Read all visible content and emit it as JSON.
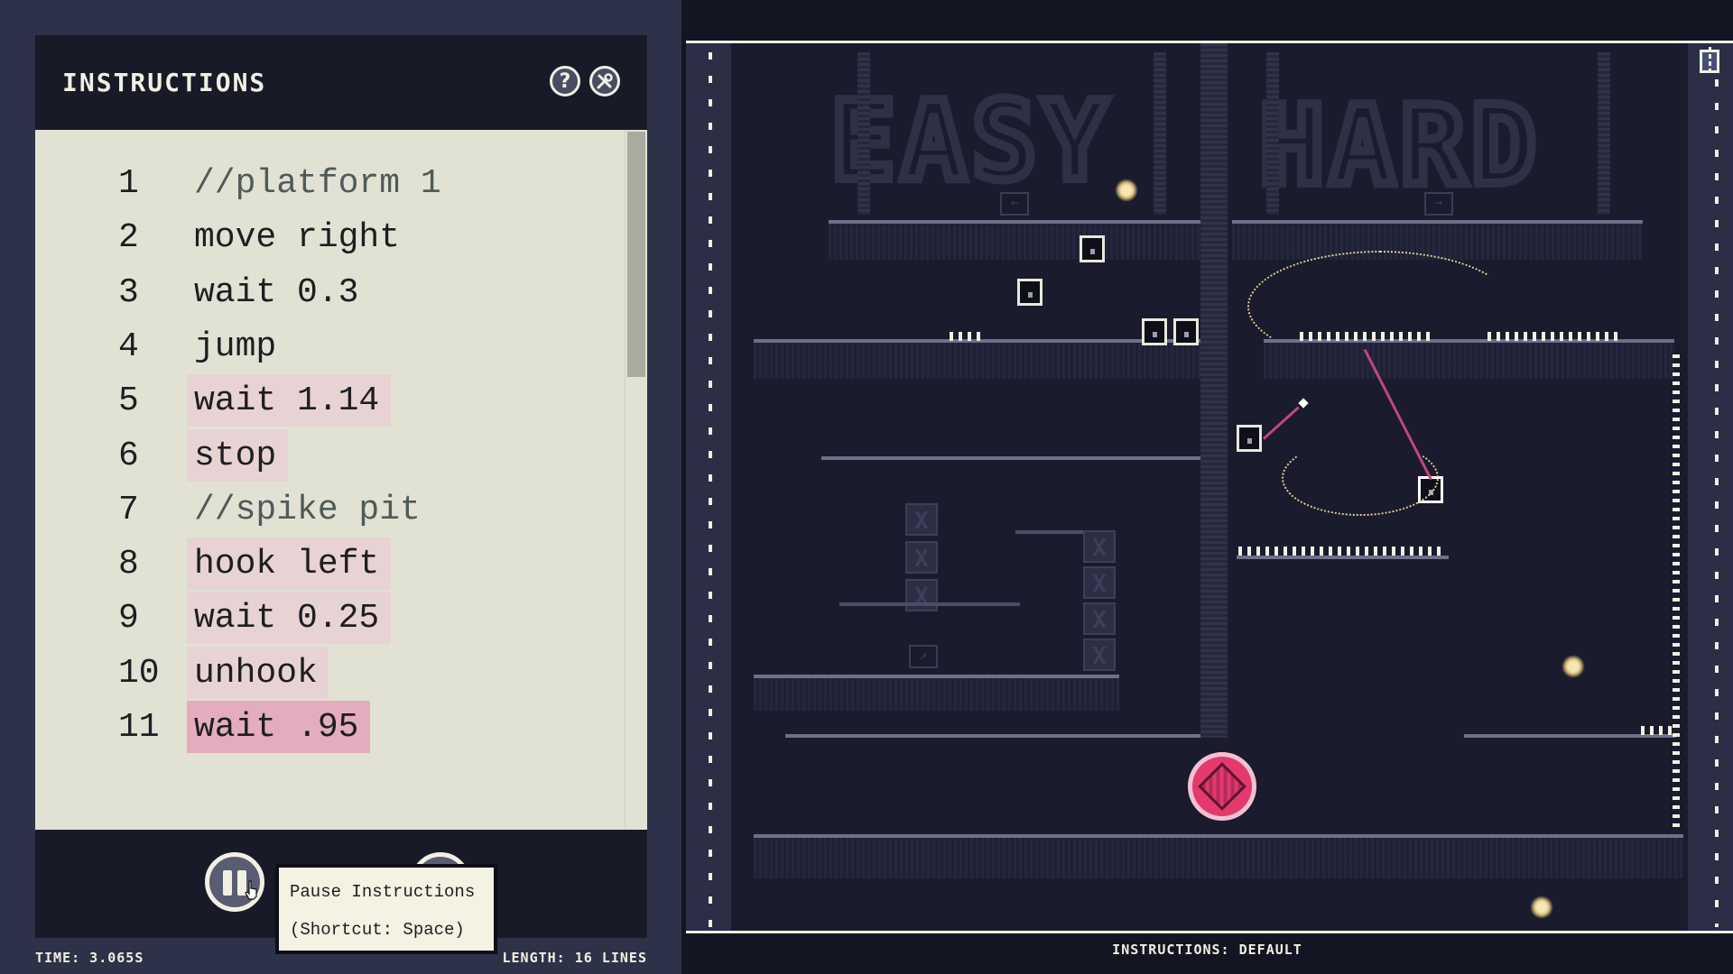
{
  "panel": {
    "title": "INSTRUCTIONS",
    "help_icon": "question-icon",
    "tools_icon": "wrench-screwdriver-icon"
  },
  "editor": {
    "lines": [
      {
        "num": "1",
        "text": "//platform 1",
        "comment": true,
        "highlight": "none"
      },
      {
        "num": "2",
        "text": "move right",
        "comment": false,
        "highlight": "none"
      },
      {
        "num": "3",
        "text": "wait 0.3",
        "comment": false,
        "highlight": "none"
      },
      {
        "num": "4",
        "text": "jump",
        "comment": false,
        "highlight": "none"
      },
      {
        "num": "5",
        "text": "wait 1.14",
        "comment": false,
        "highlight": "light"
      },
      {
        "num": "6",
        "text": "stop",
        "comment": false,
        "highlight": "light"
      },
      {
        "num": "7",
        "text": "//spike pit",
        "comment": true,
        "highlight": "none"
      },
      {
        "num": "8",
        "text": "hook left",
        "comment": false,
        "highlight": "light"
      },
      {
        "num": "9",
        "text": "wait 0.25",
        "comment": false,
        "highlight": "light"
      },
      {
        "num": "10",
        "text": "unhook",
        "comment": false,
        "highlight": "light"
      },
      {
        "num": "11",
        "text": "wait .95",
        "comment": false,
        "highlight": "active"
      }
    ],
    "scroll_fraction": 0.35
  },
  "controls": {
    "pause_icon": "pause-icon",
    "tooltip_line1": "Pause Instructions",
    "tooltip_line2": "(Shortcut: Space)"
  },
  "status": {
    "time": "TIME: 3.065S",
    "length": "LENGTH: 16 LINES",
    "instructions": "INSTRUCTIONS: DEFAULT"
  },
  "game": {
    "label_easy": "EASY",
    "label_hard": "HARD",
    "sign_easy_arrow": "←",
    "sign_hard_arrow": "→",
    "sign_lower_arrow": "↗",
    "crate_mark": "X",
    "exit_icon": "exit-door-icon"
  },
  "colors": {
    "background": "#2e3248",
    "panel_dark": "#191a28",
    "editor_bg": "#e1e2d3",
    "highlight_light": "#e7d3d3",
    "highlight_active": "#e3adbd",
    "comment": "#4f5a5a",
    "text_light": "#f1f0e2",
    "rope": "#c2477a",
    "orb": "#e3396d"
  }
}
